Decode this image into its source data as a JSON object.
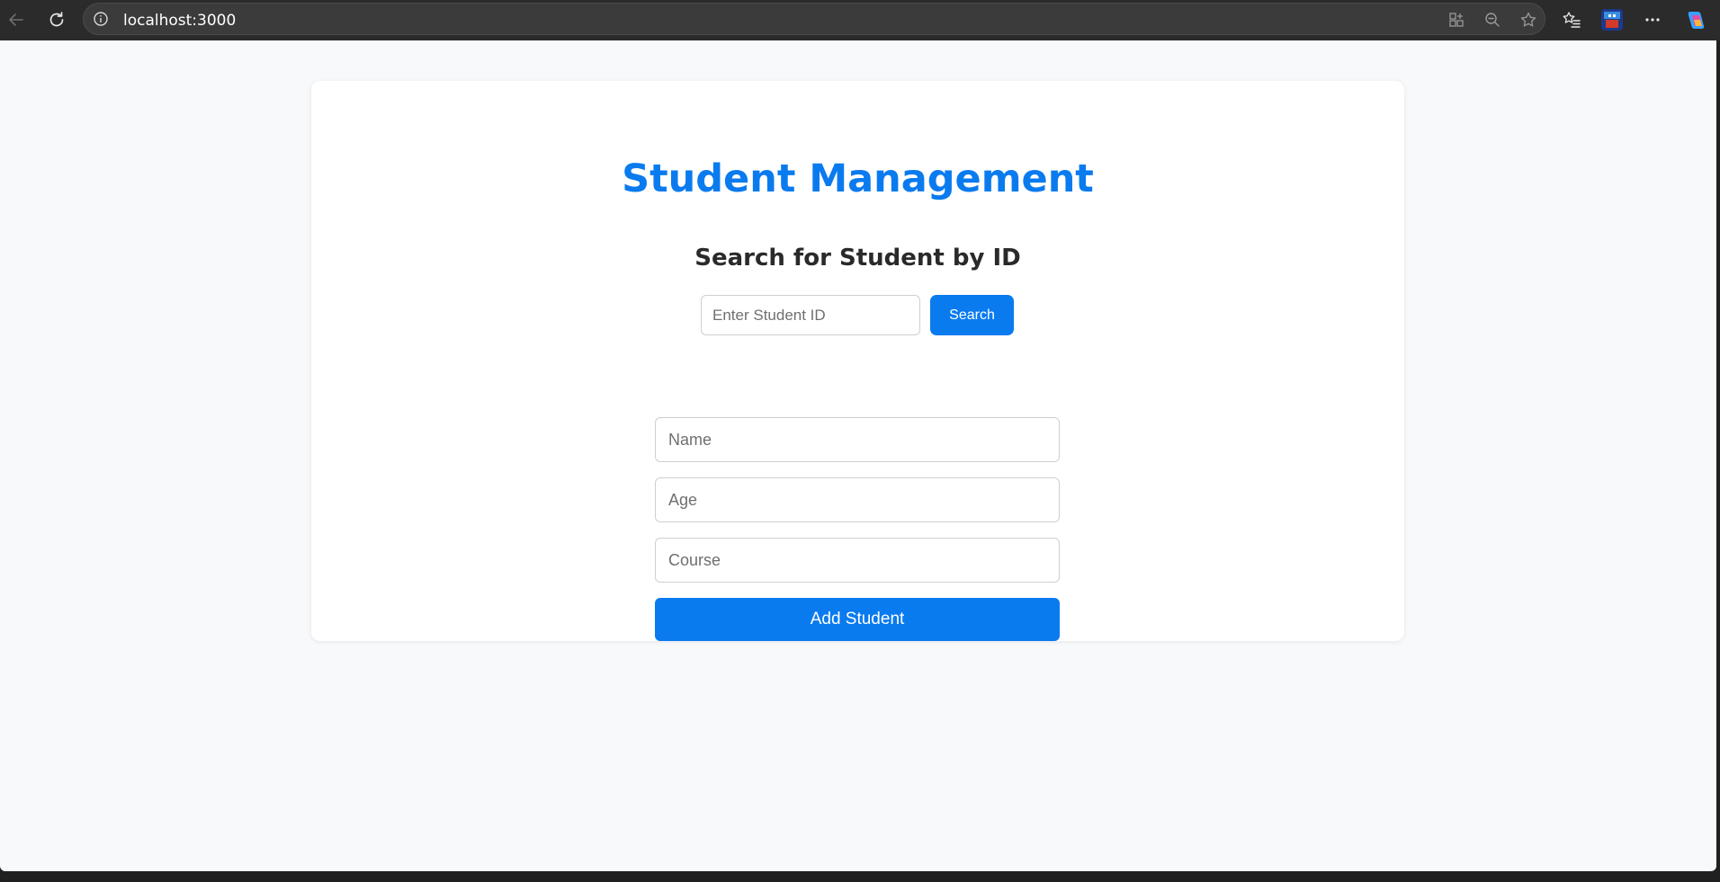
{
  "browser": {
    "url": "localhost:3000",
    "icons": [
      "back-arrow-icon",
      "refresh-icon",
      "info-icon",
      "app-grid-icon",
      "zoom-out-icon",
      "favorite-star-icon",
      "favorites-list-icon",
      "profile-avatar-icon",
      "more-options-icon",
      "copilot-icon"
    ]
  },
  "page": {
    "title": "Student Management",
    "search_heading": "Search for Student by ID",
    "search_placeholder": "Enter Student ID",
    "search_button": "Search",
    "name_placeholder": "Name",
    "age_placeholder": "Age",
    "course_placeholder": "Course",
    "add_button": "Add Student"
  },
  "colors": {
    "accent": "#0a7bef",
    "page_background": "#f7f9fb",
    "card_background": "#ffffff",
    "browser_chrome": "#2b2b2b"
  }
}
